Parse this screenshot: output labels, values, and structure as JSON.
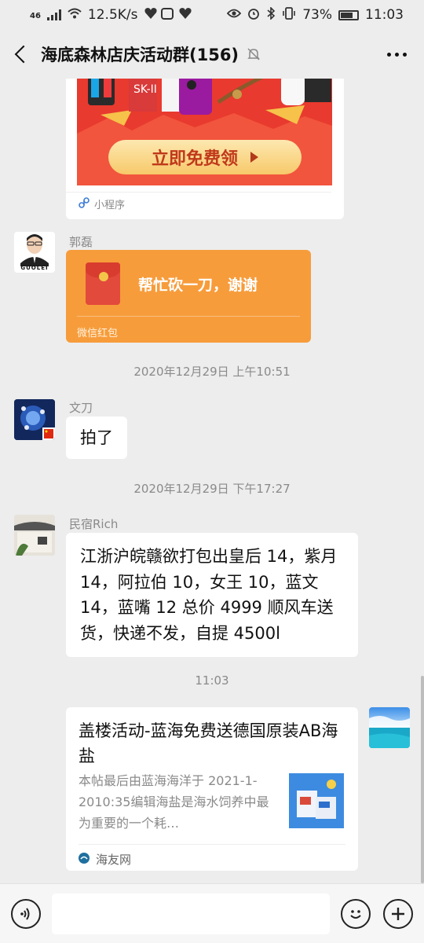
{
  "status_bar": {
    "network": "46",
    "speed": "12.5K/s",
    "battery": "73%",
    "time": "11:03"
  },
  "header": {
    "title": "海底森林店庆活动群(156)"
  },
  "messages": {
    "mini_program": {
      "button_label": "立即免费领",
      "footer_label": "小程序"
    },
    "red_packet": {
      "sender": "郭磊",
      "avatar_caption": "GUOLEI",
      "text": "帮忙砍一刀，谢谢",
      "footer_label": "微信红包"
    },
    "timestamp_1": "2020年12月29日 上午10:51",
    "reply": {
      "sender": "文刀",
      "text": "拍了"
    },
    "timestamp_2": "2020年12月29日 下午17:27",
    "listing": {
      "sender": "民宿Rich",
      "text": "江浙沪皖赣欲打包出皇后 14，紫月 14，阿拉伯 10，女王 10，蓝文 14，蓝嘴 12  总价 4999 顺风车送货，快递不发，自提 4500l"
    },
    "timestamp_3": "11:03",
    "link_card": {
      "title": "盖楼活动-蓝海免费送德国原装AB海盐",
      "description": "本帖最后由蓝海海洋于 2021-1-2010:35编辑海盐是海水饲养中最为重要的一个耗…",
      "source": "海友网"
    }
  },
  "input_bar": {
    "placeholder": ""
  }
}
